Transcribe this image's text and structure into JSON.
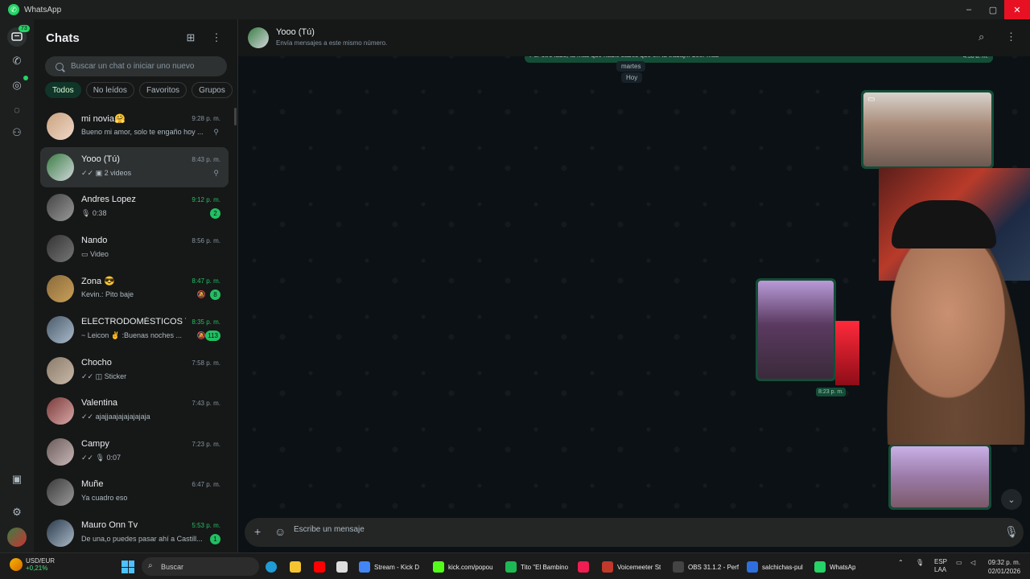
{
  "window": {
    "title": "WhatsApp",
    "controls": [
      "–",
      "▢",
      "✕"
    ]
  },
  "rail": {
    "chats_badge": "73"
  },
  "sidebar": {
    "title": "Chats",
    "search_placeholder": "Buscar un chat o iniciar uno nuevo",
    "filters": [
      "Todos",
      "No leídos",
      "Favoritos",
      "Grupos"
    ],
    "chats": [
      {
        "name": "mi novia🤗",
        "time": "9:28 p. m.",
        "preview": "Bueno mi amor, solo te engaño hoy ...",
        "pinned": true
      },
      {
        "name": "Yooo (Tú)",
        "time": "8:43 p. m.",
        "preview": "✓✓ ▣ 2 videos",
        "pinned": true,
        "selected": true
      },
      {
        "name": "Andres Lopez",
        "time": "9:12 p. m.",
        "preview": "🎙 0:38",
        "unread": "2"
      },
      {
        "name": "Nando",
        "time": "8:56 p. m.",
        "preview": "▭ Video"
      },
      {
        "name": "Zona 😎",
        "time": "8:47 p. m.",
        "preview": "Kevin.: Pito baje",
        "unread": "8",
        "muted": true
      },
      {
        "name": "ELECTRODOMÉSTICOS Y...",
        "time": "8:35 p. m.",
        "preview": "~ Leicon ✌ :Buenas noches ...",
        "unread": "113",
        "muted": true
      },
      {
        "name": "Chocho",
        "time": "7:58 p. m.",
        "preview": "✓✓ ◫ Sticker"
      },
      {
        "name": "Valentina",
        "time": "7:43 p. m.",
        "preview": "✓✓ ajajjaajajajajajaja"
      },
      {
        "name": "Campy",
        "time": "7:23 p. m.",
        "preview": "✓✓ 🎙 0:07"
      },
      {
        "name": "Muñe",
        "time": "6:47 p. m.",
        "preview": "Ya cuadro eso"
      },
      {
        "name": "Mauro Onn Tv",
        "time": "5:53 p. m.",
        "preview": "De una,o puedes pasar ahí a Castill...",
        "unread": "1"
      }
    ]
  },
  "header": {
    "name": "Yooo (Tú)",
    "subtitle": "Envía mensajes a este mismo número."
  },
  "conversation": {
    "old_message_text": "Por otro lado, tu más que nadie sabes que en tu trabaj... Leer más",
    "old_message_time": "4:58 a. m.",
    "day_label_1": "martes",
    "day_label_2": "Hoy",
    "media_time": "8:23 p. m."
  },
  "composer": {
    "placeholder": "Escribe un mensaje"
  },
  "taskbar": {
    "weather_label": "USD/EUR",
    "weather_value": "+0,21%",
    "search_label": "Buscar",
    "apps": [
      {
        "label": "Stream - Kick D",
        "color": "#4285f4"
      },
      {
        "label": "kick.com/popou",
        "color": "#53fc18"
      },
      {
        "label": "Tito \"El Bambino",
        "color": "#1db954"
      },
      {
        "label": "",
        "color": "#ee1d52"
      },
      {
        "label": "Voicemeeter St",
        "color": "#c0392b"
      },
      {
        "label": "OBS 31.1.2 - Perf",
        "color": "#444444"
      },
      {
        "label": "salchichas-pul",
        "color": "#2f6fdd"
      },
      {
        "label": "WhatsAp",
        "color": "#25d366"
      }
    ],
    "lang_top": "ESP",
    "lang_bottom": "LAA",
    "time": "09:32 p. m.",
    "date": "02/01/2026"
  }
}
